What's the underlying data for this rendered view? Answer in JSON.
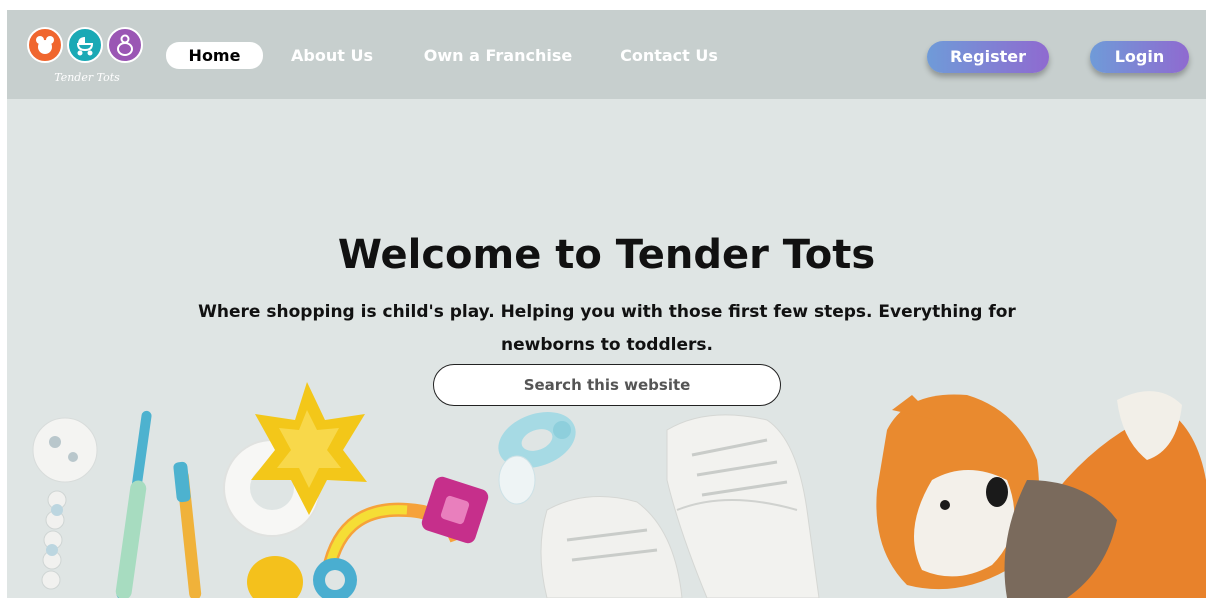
{
  "brand": {
    "name": "Tender Tots",
    "logo_icons": [
      "teddy-bear-icon",
      "baby-stroller-icon",
      "pacifier-icon"
    ]
  },
  "nav": {
    "items": [
      {
        "label": "Home",
        "active": true
      },
      {
        "label": "About Us",
        "active": false
      },
      {
        "label": "Own a Franchise",
        "active": false
      },
      {
        "label": "Contact Us",
        "active": false
      }
    ],
    "register_label": "Register",
    "login_label": "Login"
  },
  "hero": {
    "title": "Welcome to Tender Tots",
    "subtitle": "Where shopping is child's play. Helping you with those first few steps. Everything for newborns to toddlers.",
    "search_placeholder": "Search this website"
  },
  "colors": {
    "logo_orange": "#f0662e",
    "logo_teal": "#1aa9b5",
    "logo_purple": "#9a56b4",
    "button_gradient_start": "#6f9bd8",
    "button_gradient_end": "#8f6ad0",
    "navbar_bg": "#c7cfce",
    "hero_bg": "#dfe5e4"
  }
}
